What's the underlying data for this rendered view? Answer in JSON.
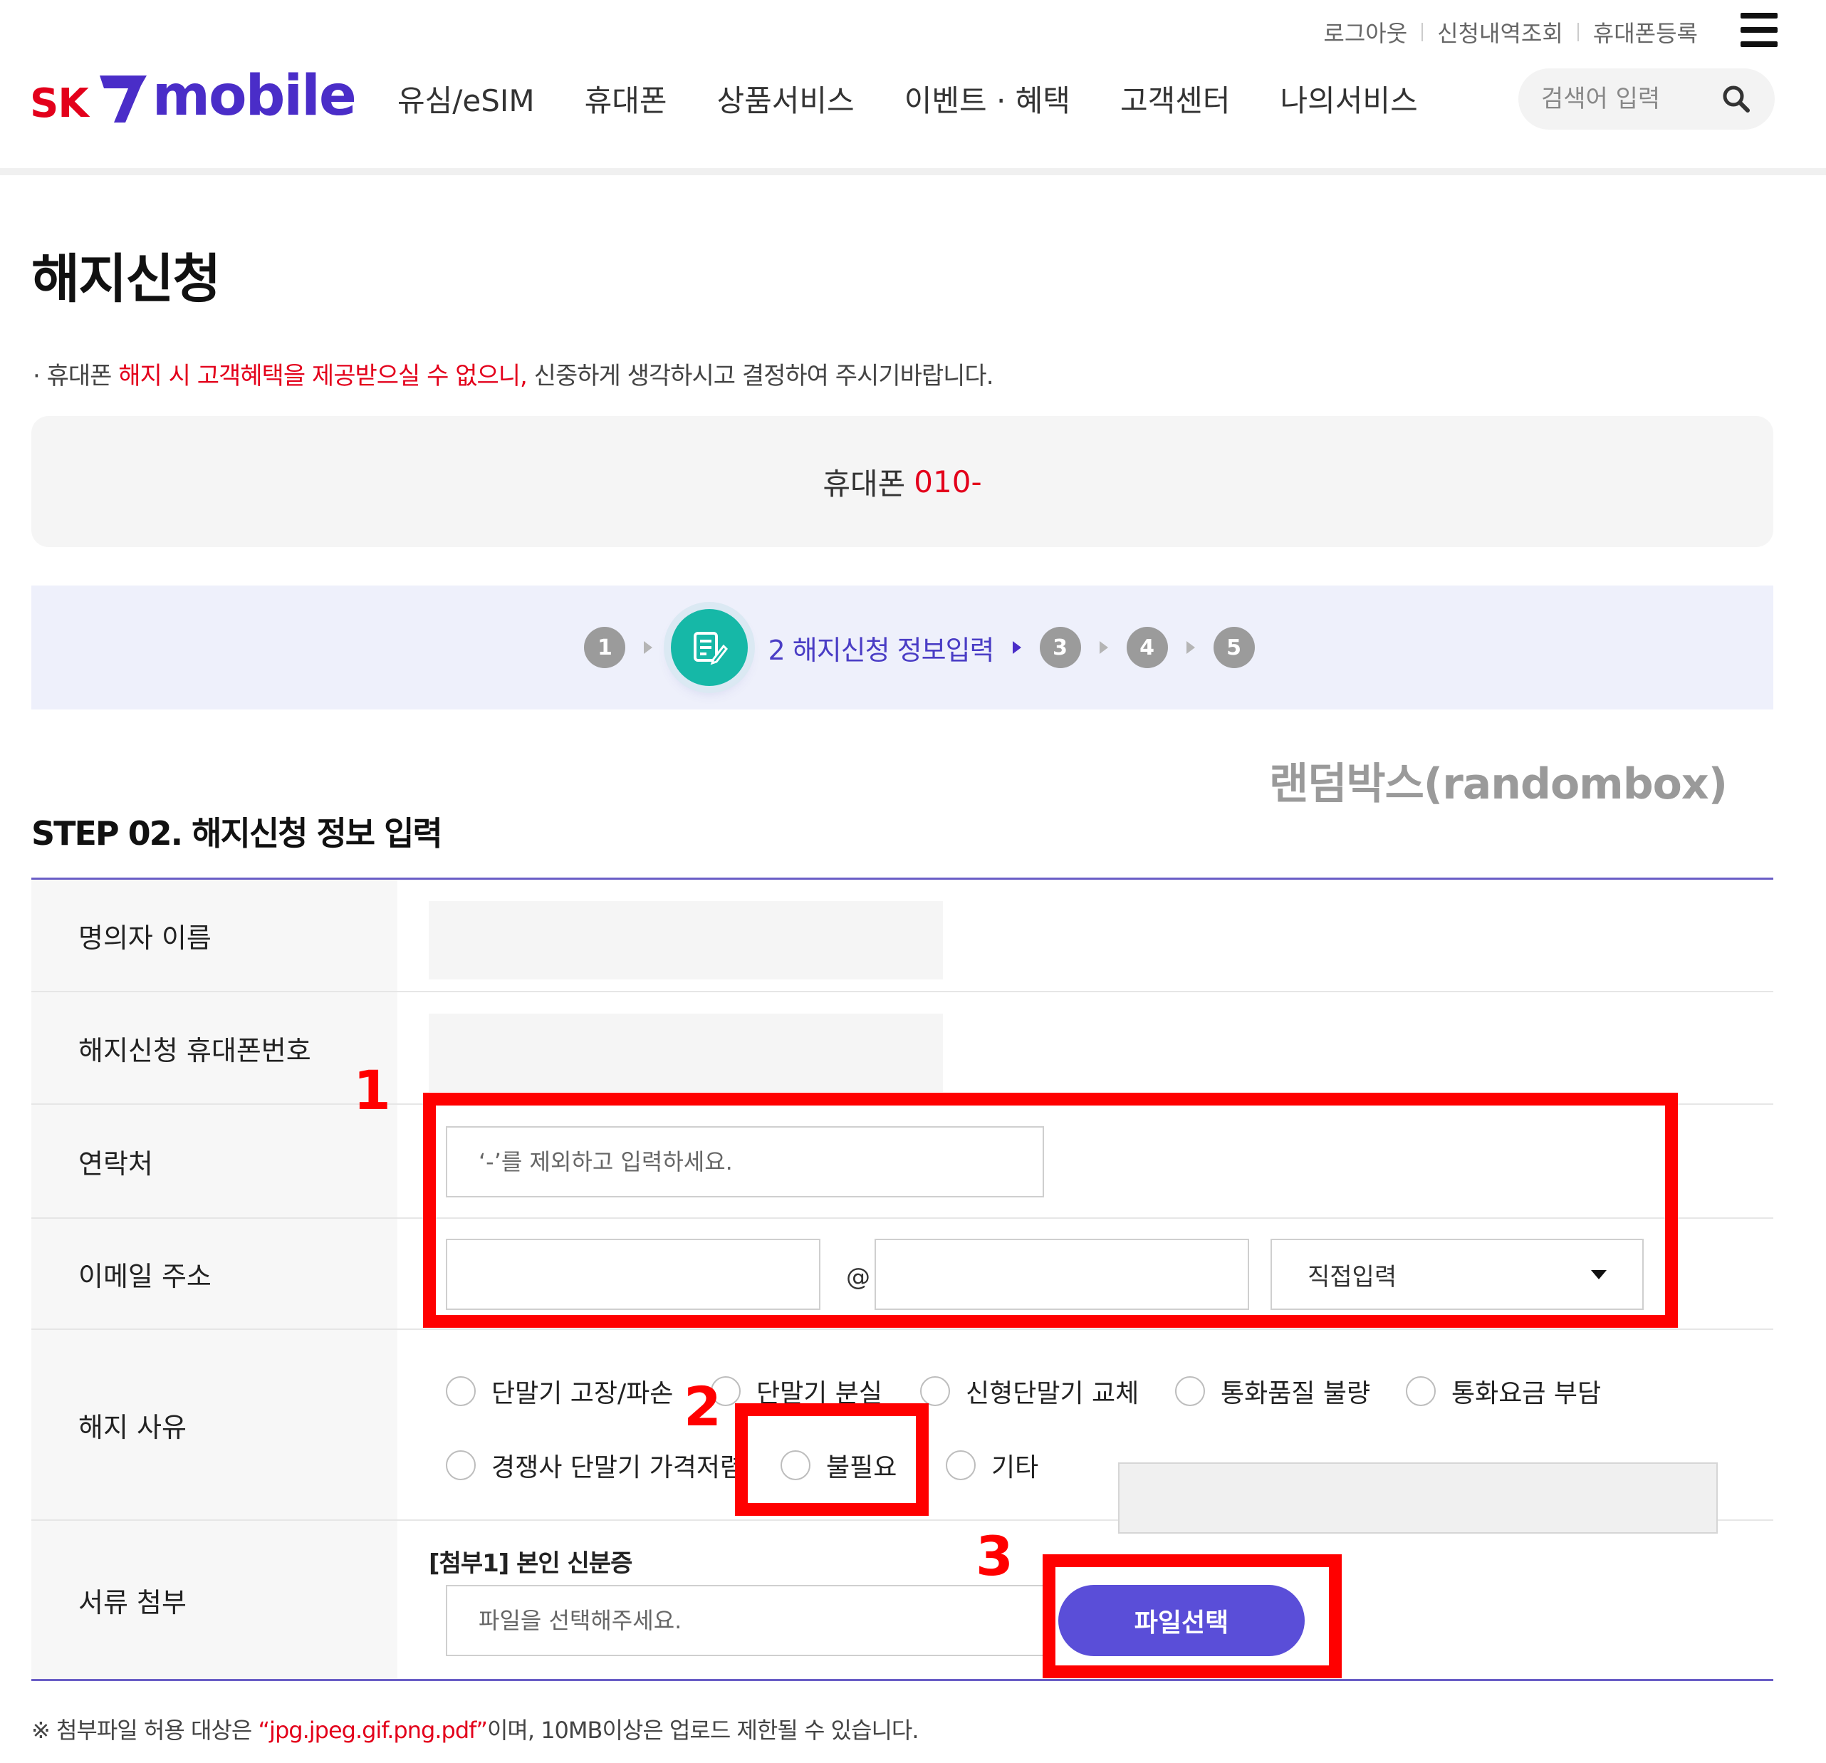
{
  "header": {
    "top_links": [
      "로그아웃",
      "신청내역조회",
      "휴대폰등록"
    ],
    "logo": {
      "sk": "SK",
      "mobile": "mobile"
    },
    "gnb": [
      "유심/eSIM",
      "휴대폰",
      "상품서비스",
      "이벤트 · 혜택",
      "고객센터",
      "나의서비스"
    ],
    "search_placeholder": "검색어 입력"
  },
  "page": {
    "title": "해지신청",
    "notice_prefix": "· 휴대폰 ",
    "notice_red": "해지 시 고객혜택을 제공받으실 수 없으니,",
    "notice_suffix": " 신중하게 생각하시고 결정하여 주시기바랍니다.",
    "phone_label": "휴대폰",
    "phone_number": "010-"
  },
  "steps": {
    "items": [
      "1",
      "3",
      "4",
      "5"
    ],
    "active_label": "2 해지신청 정보입력"
  },
  "watermark": "랜덤박스(randombox)",
  "section_title": "STEP 02. 해지신청 정보 입력",
  "form": {
    "name_label": "명의자 이름",
    "phone_label": "해지신청 휴대폰번호",
    "contact_label": "연락처",
    "contact_placeholder": "‘-’를 제외하고 입력하세요.",
    "email_label": "이메일 주소",
    "email_at": "@",
    "email_domain_select": "직접입력",
    "reason_label": "해지 사유",
    "reasons": [
      "단말기 고장/파손",
      "단말기 분실",
      "신형단말기 교체",
      "통화품질 불량",
      "통화요금 부담",
      "경쟁사 단말기 가격저렴",
      "불필요",
      "기타"
    ],
    "docs_label": "서류 첨부",
    "attach1_label": "[첨부1] 본인 신분증",
    "file_placeholder": "파일을 선택해주세요.",
    "file_button": "파일선택"
  },
  "footnote": {
    "prefix": "※ 첨부파일 허용 대상은 ",
    "red": "“jpg.jpeg.gif.png.pdf”",
    "suffix": "이며, 10MB이상은 업로드 제한될 수 있습니다."
  },
  "annotations": [
    "1",
    "2",
    "3"
  ],
  "colors": {
    "brand_red": "#e3001b",
    "brand_purple": "#4a2dc8",
    "button": "#5a4ed8",
    "step_active": "#16b8a7",
    "annotation": "#ff0000"
  }
}
